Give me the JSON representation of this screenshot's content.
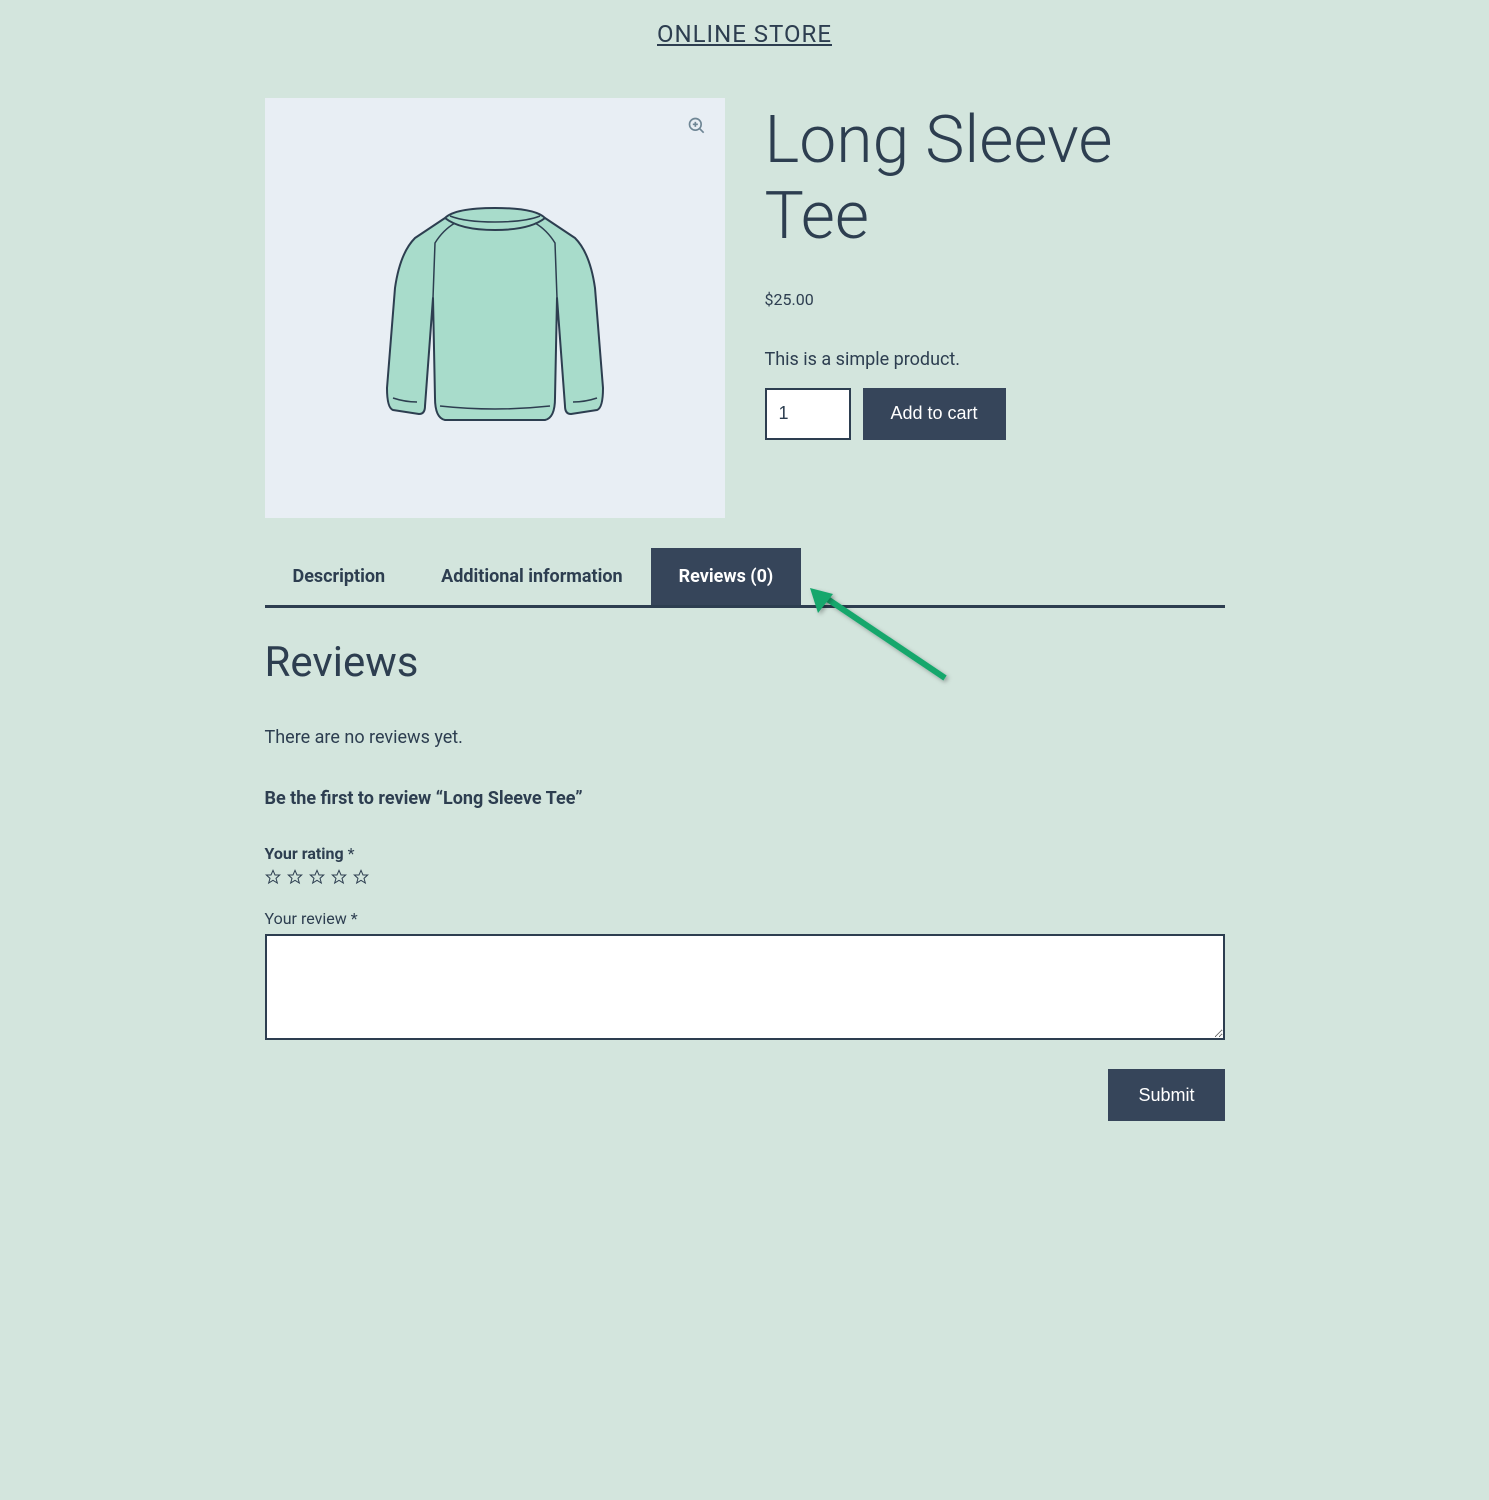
{
  "store": {
    "title": "ONLINE STORE"
  },
  "product": {
    "title": "Long Sleeve Tee",
    "price": "$25.00",
    "description": "This is a simple product.",
    "qty": "1",
    "add_to_cart_label": "Add to cart"
  },
  "tabs": {
    "description": "Description",
    "additional_info": "Additional information",
    "reviews": "Reviews (0)"
  },
  "reviews": {
    "heading": "Reviews",
    "no_reviews_text": "There are no reviews yet.",
    "prompt": "Be the first to review “Long Sleeve Tee”",
    "rating_label": "Your rating ",
    "review_label": "Your review ",
    "required_mark": "*",
    "submit_label": "Submit"
  }
}
